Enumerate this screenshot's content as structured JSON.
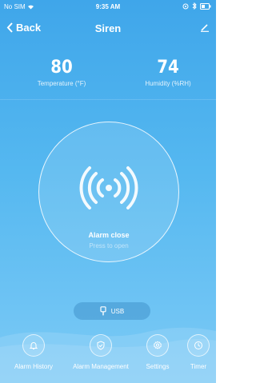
{
  "status_bar": {
    "carrier": "No SIM",
    "time": "9:35 AM"
  },
  "nav": {
    "back_label": "Back",
    "title": "Siren"
  },
  "metrics": {
    "temperature": {
      "value": "80",
      "label": "Temperature (°F)"
    },
    "humidity": {
      "value": "74",
      "label": "Humidity (%RH)"
    }
  },
  "alarm": {
    "status": "Alarm close",
    "hint": "Press to open"
  },
  "usb_label": "USB",
  "tabs": [
    {
      "label": "Alarm History",
      "icon": "bell-icon"
    },
    {
      "label": "Alarm Management",
      "icon": "shield-check-icon"
    },
    {
      "label": "Settings",
      "icon": "gear-icon"
    },
    {
      "label": "Timer",
      "icon": "clock-icon"
    }
  ],
  "colors": {
    "background_top": "#3fa6ea",
    "background_bottom": "#7ccaf6",
    "foreground": "#ffffff"
  }
}
